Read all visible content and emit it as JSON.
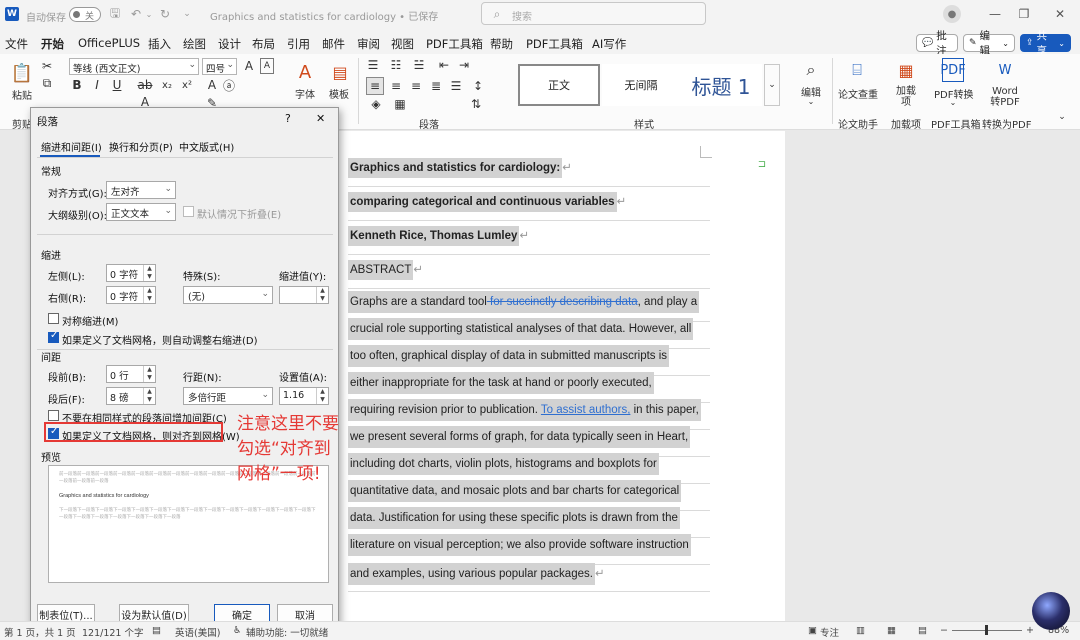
{
  "titlebar": {
    "autosave_label": "自动保存",
    "autosave_state": "关",
    "doc_title": "Graphics and statistics for cardiology • 已保存",
    "search_placeholder": "搜索"
  },
  "tabs": [
    "文件",
    "开始",
    "OfficePLUS",
    "插入",
    "绘图",
    "设计",
    "布局",
    "引用",
    "邮件",
    "审阅",
    "视图",
    "PDF工具箱",
    "帮助",
    "PDF工具箱",
    "AI写作"
  ],
  "tab_actions": {
    "comment": "批注",
    "edit": "编辑",
    "share": "共享"
  },
  "ribbon": {
    "paste": "粘贴",
    "clipboard_group": "剪贴",
    "font_name": "等线 (西文正文)",
    "font_size": "四号",
    "font_btn": "字体",
    "template_btn": "模板",
    "paragraph_group": "段落",
    "styles": [
      "正文",
      "无间隔",
      "标题 1"
    ],
    "styles_group": "样式",
    "edit_btn": "编辑",
    "review_btn": "论文查重",
    "review_group": "论文助手",
    "addin_btn": "加载项",
    "addin_group": "加载项",
    "pdfconv_btn": "PDF转换",
    "pdf_group": "PDF工具箱",
    "word2pdf_btn": "Word转PDF",
    "convert_group": "转换为PDF"
  },
  "dialog": {
    "title": "段落",
    "help": "?",
    "close": "✕",
    "tabs": [
      "缩进和间距(I)",
      "换行和分页(P)",
      "中文版式(H)"
    ],
    "general": {
      "section": "常规",
      "align_label": "对齐方式(G):",
      "align_value": "左对齐",
      "outline_label": "大纲级别(O):",
      "outline_value": "正文文本",
      "collapse_label": "默认情况下折叠(E)"
    },
    "indent": {
      "section": "缩进",
      "left_label": "左侧(L):",
      "left_value": "0 字符",
      "right_label": "右侧(R):",
      "right_value": "0 字符",
      "special_label": "特殊(S):",
      "special_value": "(无)",
      "by_label": "缩进值(Y):",
      "mirror_label": "对称缩进(M)",
      "auto_label": "如果定义了文档网格，则自动调整右缩进(D)"
    },
    "spacing": {
      "section": "间距",
      "before_label": "段前(B):",
      "before_value": "0 行",
      "after_label": "段后(F):",
      "after_value": "8 磅",
      "line_label": "行距(N):",
      "line_value": "多倍行距",
      "at_label": "设置值(A):",
      "at_value": "1.16",
      "nospace_label": "不要在相同样式的段落间增加间距(C)",
      "grid_label": "如果定义了文档网格，则对齐到网格(W)"
    },
    "preview": {
      "section": "预览",
      "prev_text": "前一段落前一段落前一段落前一段落前一段落前一段落前一段落前一段落前一段落前一段落前一段落前一段落前一段落前一段落前一段落前一段落前一段落",
      "sample": "Graphics and statistics for cardiology",
      "next_text": "下一段落下一段落下一段落下一段落下一段落下一段落下一段落下一段落下一段落下一段落下一段落下一段落下一段落下一段落下一段落下一段落下一段落下一段落下一段落下一段落下一段落"
    },
    "buttons": {
      "tabs": "制表位(T)...",
      "default": "设为默认值(D)",
      "ok": "确定",
      "cancel": "取消"
    }
  },
  "annotation": "注意这里不要\n勾选“对齐到\n网格”一项!",
  "document": {
    "title1": "Graphics and statistics for cardiology:",
    "title2": "comparing categorical and continuous variables",
    "authors": "Kenneth Rice, Thomas Lumley",
    "abstract_heading": "ABSTRACT",
    "l1a": "Graphs are a standard tool",
    "l1del": " for succinctly describing data",
    "l1b": ", and play a",
    "l2": "crucial role supporting statistical analyses of that data. However, all",
    "l3": "too often, graphical display of data in submitted manuscripts is",
    "l4": "either inappropriate for the task at hand or poorly executed,",
    "l5a": "requiring revision prior to publication. ",
    "l5ins": "To assist authors,",
    "l5b": " in this paper,",
    "l6": "we present several forms of graph, for data typically seen in Heart,",
    "l7": "including dot charts, violin plots, histograms and boxplots for",
    "l8": "quantitative data, and mosaic plots and bar charts for categorical",
    "l9": "data. Justification for using these specific plots is drawn from the",
    "l10": "literature on visual perception; we also provide software instruction",
    "l11": "and examples, using various popular packages."
  },
  "status": {
    "page": "第 1 页，共 1 页",
    "words": "121/121 个字",
    "lang": "英语(美国)",
    "access": "辅助功能: 一切就绪",
    "focus": "专注",
    "zoom": "88%"
  },
  "colors": {
    "accent": "#185abd",
    "annotation": "#e53935",
    "track_change": "#2f6fd0"
  }
}
